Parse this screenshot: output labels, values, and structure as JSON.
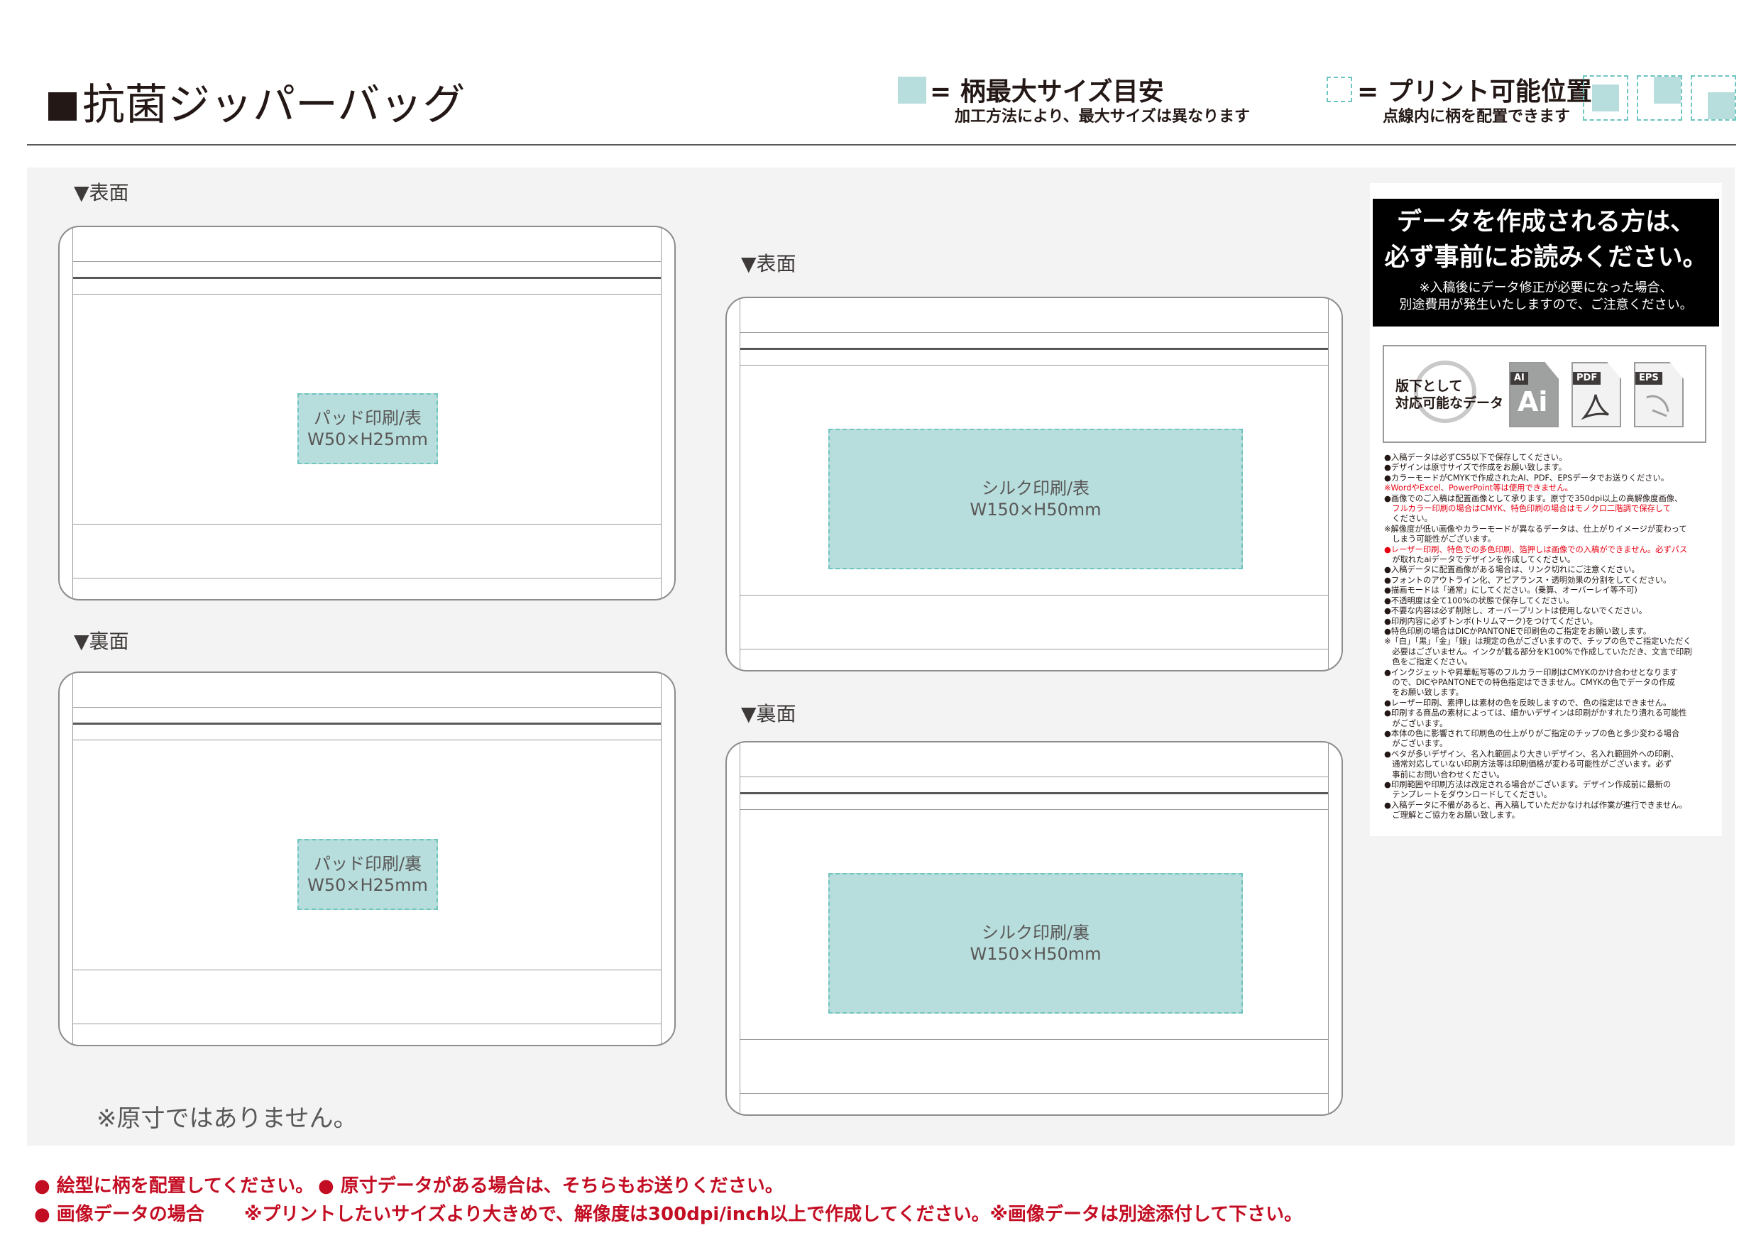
{
  "header": {
    "title": "抗菌ジッパーバッグ",
    "legend_max": "= 柄最大サイズ目安",
    "legend_max_sub": "加工方法により、最大サイズは異なります",
    "legend_print": "= プリント可能位置",
    "legend_print_sub": "点線内に柄を配置できます"
  },
  "views": [
    {
      "label": "▼表面",
      "print_line1": "パッド印刷/表",
      "print_line2": "W50×H25mm"
    },
    {
      "label": "▼裏面",
      "print_line1": "パッド印刷/裏",
      "print_line2": "W50×H25mm"
    },
    {
      "label": "▼表面",
      "print_line1": "シルク印刷/表",
      "print_line2": "W150×H50mm"
    },
    {
      "label": "▼裏面",
      "print_line1": "シルク印刷/裏",
      "print_line2": "W150×H50mm"
    }
  ],
  "scale_note": "※原寸ではありません。",
  "panel": {
    "warning_title1": "データを作成される方は、",
    "warning_title2": "必ず事前にお読みください。",
    "warning_sub1": "※入稿後にデータ修正が必要になった場合、",
    "warning_sub2": "別途費用が発生いたしますので、ご注意ください。",
    "formats_label1": "版下として",
    "formats_label2": "対応可能なデータ",
    "format_tags": [
      "AI",
      "PDF",
      "EPS"
    ],
    "rules": [
      "●入稿データは必ずCS5以下で保存してください。",
      "●デザインは原寸サイズで作成をお願い致します。",
      "●カラーモードがCMYKで作成されたAI、PDF、EPSデータでお送りください。",
      "※WordやExcel、PowerPoint等は使用できません。",
      "●画像でのご入稿は配置画像として承ります。原寸で350dpi以上の高解像度画像、",
      "　フルカラー印刷の場合はCMYK、特色印刷の場合はモノクロ二階調で保存して",
      "　ください。",
      "※解像度が低い画像やカラーモードが異なるデータは、仕上がりイメージが変わって",
      "　しまう可能性がございます。",
      "●レーザー印刷、特色での多色印刷、箔押しは画像での入稿ができません。必ずパス",
      "　が取れたaiデータでデザインを作成してください。",
      "●入稿データに配置画像がある場合は、リンク切れにご注意ください。",
      "●フォントのアウトライン化、アピアランス・透明効果の分割をしてください。",
      "●描画モードは「通常」にしてください。(乗算、オーバーレイ等不可)",
      "●不透明度は全て100%の状態で保存してください。",
      "●不要な内容は必ず削除し、オーバープリントは使用しないでください。",
      "●印刷内容に必ずトンボ(トリムマーク)をつけてください。",
      "●特色印刷の場合はDICかPANTONEで印刷色のご指定をお願い致します。",
      "※「白」「黒」「金」「銀」は規定の色がございますので、チップの色でご指定いただく",
      "　必要はございません。インクが載る部分をK100%で作成していただき、文言で印刷",
      "　色をご指定ください。",
      "●インクジェットや昇華転写等のフルカラー印刷はCMYKのかけ合わせとなります",
      "　ので、DICやPANTONEでの特色指定はできません。CMYKの色でデータの作成",
      "　をお願い致します。",
      "●レーザー印刷、素押しは素材の色を反映しますので、色の指定はできません。",
      "●印刷する商品の素材によっては、細かいデザインは印刷がかすれたり潰れる可能性",
      "　がございます。",
      "●本体の色に影響されて印刷色の仕上がりがご指定のチップの色と多少変わる場合",
      "　がございます。",
      "●ベタが多いデザイン、名入れ範囲より大きいデザイン、名入れ範囲外への印刷、",
      "　通常対応していない印刷方法等は印刷価格が変わる可能性がございます。必ず",
      "　事前にお問い合わせください。",
      "●印刷範囲や印刷方法は改定される場合がございます。デザイン作成前に最新の",
      "　テンプレートをダウンロードしてください。",
      "●入稿データに不備があると、再入稿していただかなければ作業が進行できません。",
      "　ご理解とご協力をお願い致します。"
    ]
  },
  "footer": {
    "line1a": "● 絵型に柄を配置してください。",
    "line1b": "● 原寸データがある場合は、そちらもお送りください。",
    "line2a": "● 画像データの場合",
    "line2b": "※プリントしたいサイズより大きめで、解像度は300dpi/inch以上で作成してください。※画像データは別途添付して下さい。"
  },
  "colors": {
    "print_area_fill": "#b7dedc",
    "print_area_border": "#6ec4bf",
    "footer_red": "#c30d23",
    "rule_red": "#e60012"
  }
}
